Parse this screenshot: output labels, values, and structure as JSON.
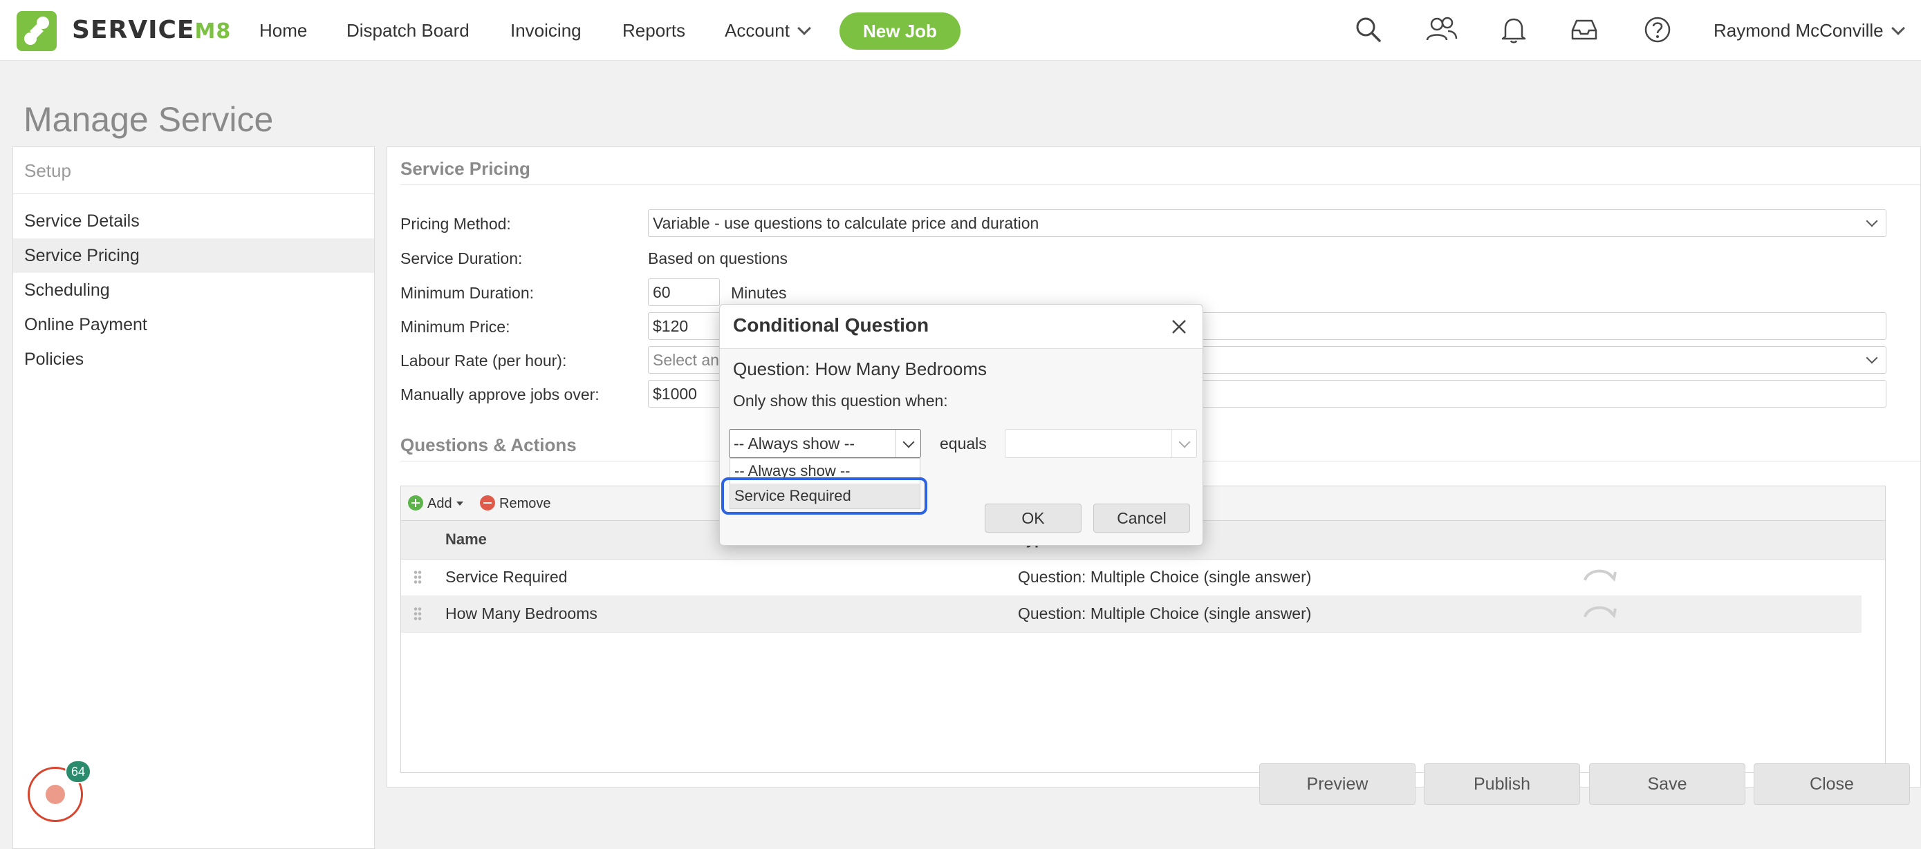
{
  "app": {
    "brand_main": "SERVICE",
    "brand_accent": "M8",
    "accent_color": "#7cc142"
  },
  "nav": {
    "home": "Home",
    "dispatch": "Dispatch Board",
    "invoicing": "Invoicing",
    "reports": "Reports",
    "account": "Account",
    "new_job": "New Job",
    "user": "Raymond McConville",
    "icons": [
      "search-icon",
      "people-icon",
      "bell-icon",
      "inbox-icon",
      "help-icon"
    ]
  },
  "page": {
    "title": "Manage Service"
  },
  "sidebar": {
    "heading": "Setup",
    "items": [
      {
        "label": "Service Details"
      },
      {
        "label": "Service Pricing"
      },
      {
        "label": "Scheduling"
      },
      {
        "label": "Online Payment"
      },
      {
        "label": "Policies"
      }
    ],
    "notification_count": "64"
  },
  "pricing": {
    "section_title": "Service Pricing",
    "method_label": "Pricing Method:",
    "method_value": "Variable - use questions to calculate price and duration",
    "duration_label": "Service Duration:",
    "duration_value": "Based on questions",
    "min_duration_label": "Minimum Duration:",
    "min_duration_value": "60",
    "min_duration_unit": "Minutes",
    "min_price_label": "Minimum Price:",
    "min_price_value": "$120",
    "labour_label": "Labour Rate (per hour):",
    "labour_placeholder": "Select an",
    "approve_label": "Manually approve jobs over:",
    "approve_value": "$1000"
  },
  "questions": {
    "section_title": "Questions & Actions",
    "add_label": "Add",
    "remove_label": "Remove",
    "col_name": "Name",
    "col_type": "Type",
    "rows": [
      {
        "name": "Service Required",
        "type": "Question: Multiple Choice (single answer)"
      },
      {
        "name": "How Many Bedrooms",
        "type": "Question: Multiple Choice (single answer)"
      }
    ]
  },
  "footer": {
    "preview": "Preview",
    "publish": "Publish",
    "save": "Save",
    "close": "Close"
  },
  "dialog": {
    "title": "Conditional Question",
    "question": "Question: How Many Bedrooms",
    "instruction": "Only show this question when:",
    "selected": "-- Always show --",
    "equals": "equals",
    "options": [
      "-- Always show --",
      "Service Required"
    ],
    "ok": "OK",
    "cancel": "Cancel"
  }
}
